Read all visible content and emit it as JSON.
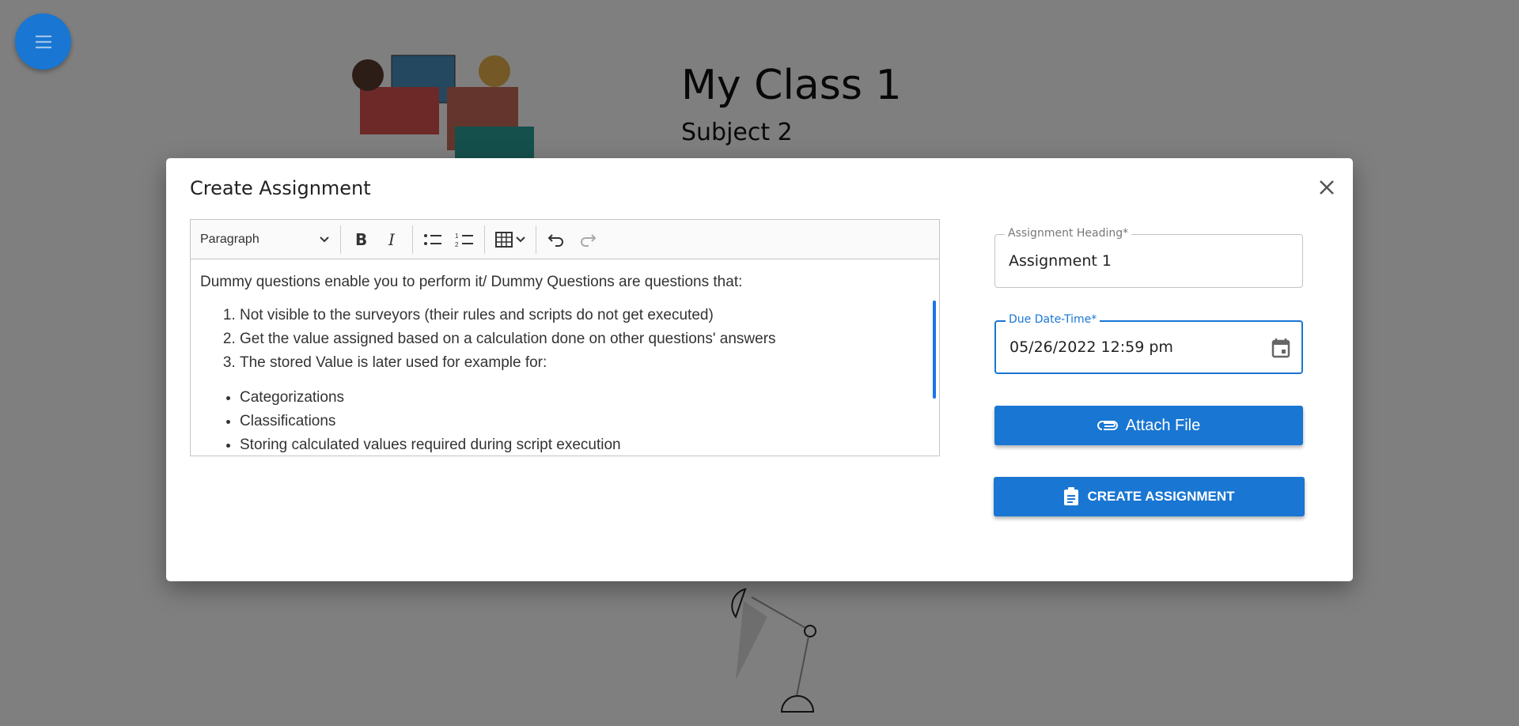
{
  "page": {
    "class_title": "My Class 1",
    "subject": "Subject 2"
  },
  "modal": {
    "title": "Create Assignment",
    "editor": {
      "block_format": "Paragraph",
      "intro": "Dummy questions enable you to perform it/ Dummy Questions are questions that:",
      "ordered": [
        "Not visible to the surveyors (their rules and scripts do not get executed)",
        "Get the value assigned based on a calculation done on other questions' answers",
        "The stored Value is later used for example for:"
      ],
      "bullets": [
        "Categorizations",
        "Classifications",
        "Storing calculated values required during script execution"
      ]
    },
    "heading_field": {
      "label": "Assignment Heading*",
      "value": "Assignment 1"
    },
    "due_field": {
      "label": "Due Date-Time*",
      "value": "05/26/2022 12:59 pm"
    },
    "attach_label": "Attach File",
    "create_label": "CREATE ASSIGNMENT"
  },
  "colors": {
    "primary": "#1976d2",
    "overlay": "#808080"
  }
}
